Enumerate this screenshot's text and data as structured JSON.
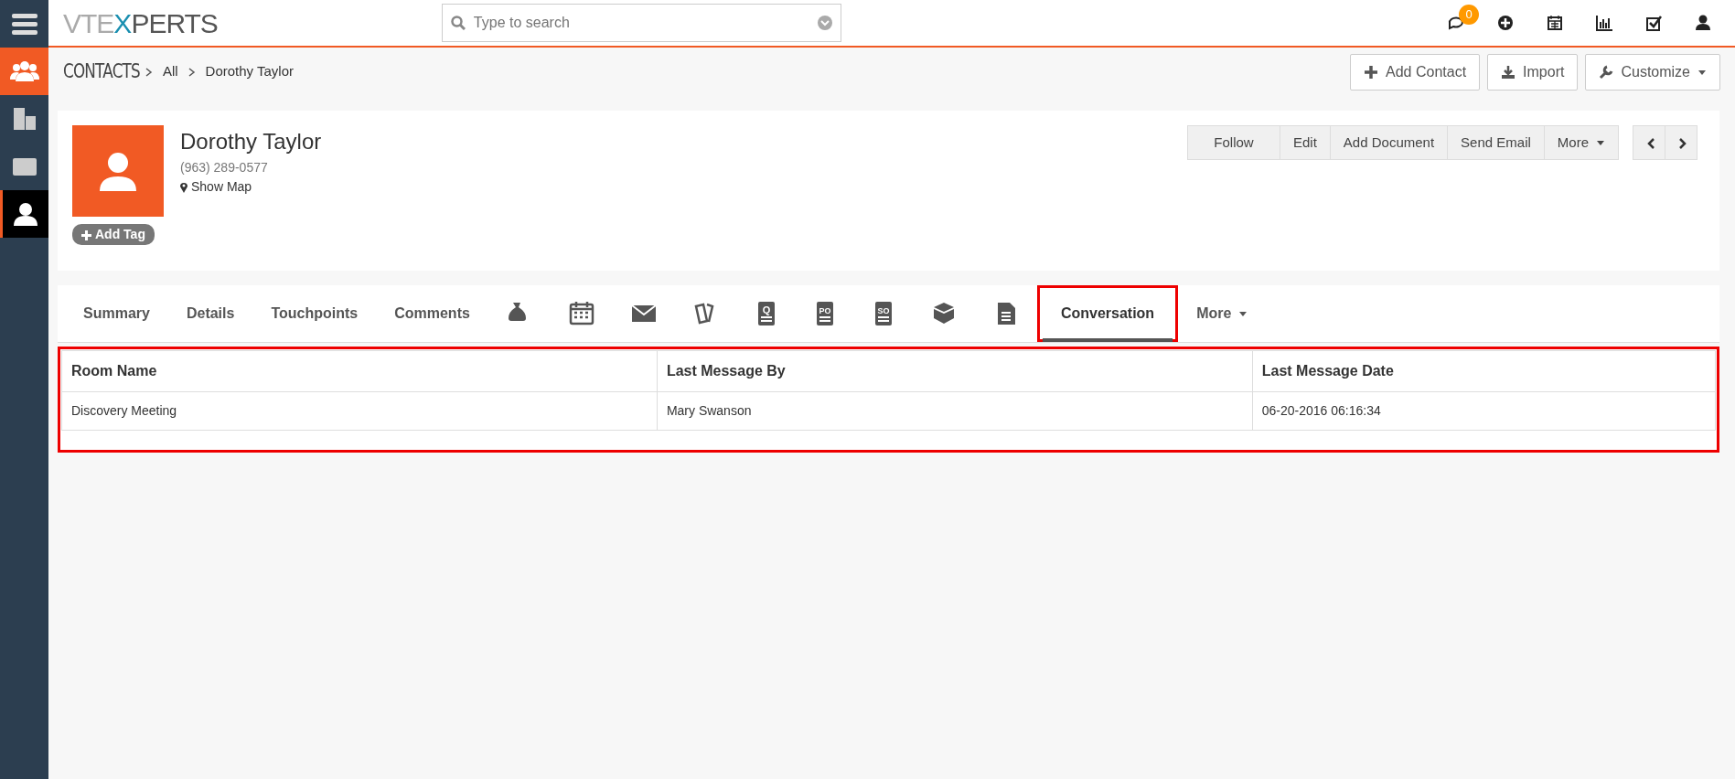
{
  "logo": {
    "part1": "VTE",
    "part2": "X",
    "part3": "PERTS"
  },
  "search": {
    "placeholder": "Type to search"
  },
  "top_icons": [
    {
      "kind": "chat",
      "badge": "0"
    },
    {
      "kind": "plus"
    },
    {
      "kind": "calendar"
    },
    {
      "kind": "chart"
    },
    {
      "kind": "task"
    },
    {
      "kind": "user"
    }
  ],
  "sidebar": {
    "items": [
      {
        "kind": "group",
        "selected": false,
        "color": "#f15a24"
      },
      {
        "kind": "building",
        "selected": false,
        "color": "#2c3e50"
      },
      {
        "kind": "card",
        "selected": false,
        "color": "#2c3e50"
      },
      {
        "kind": "user",
        "selected": true,
        "color": "#000000"
      }
    ]
  },
  "breadcrumb": {
    "module": "CONTACTS",
    "items": [
      "All",
      "Dorothy Taylor"
    ]
  },
  "header_buttons": [
    {
      "kind": "plus",
      "label": "Add Contact"
    },
    {
      "kind": "import",
      "label": "Import"
    },
    {
      "kind": "wrench",
      "label": "Customize",
      "caret": true
    }
  ],
  "record": {
    "name": "Dorothy Taylor",
    "phone": "(963) 289-0577",
    "map": "Show Map",
    "tag_button": "Add Tag"
  },
  "actions": [
    {
      "label": "Follow",
      "caret": false
    },
    {
      "label": "Edit",
      "caret": false
    },
    {
      "label": "Add Document",
      "caret": false
    },
    {
      "label": "Send Email",
      "caret": false
    },
    {
      "label": "More",
      "caret": true
    }
  ],
  "tabs": [
    {
      "kind": "text",
      "label": "Summary",
      "selected": false,
      "highlighted": false
    },
    {
      "kind": "text",
      "label": "Details",
      "selected": false,
      "highlighted": false
    },
    {
      "kind": "text",
      "label": "Touchpoints",
      "selected": false,
      "highlighted": false
    },
    {
      "kind": "text",
      "label": "Comments",
      "selected": false,
      "highlighted": false
    },
    {
      "kind": "money",
      "selected": false,
      "highlighted": false
    },
    {
      "kind": "calendar",
      "selected": false,
      "highlighted": false
    },
    {
      "kind": "mail",
      "selected": false,
      "highlighted": false
    },
    {
      "kind": "tickets",
      "selected": false,
      "highlighted": false
    },
    {
      "kind": "doc",
      "label": "Q",
      "selected": false,
      "highlighted": false
    },
    {
      "kind": "doc",
      "label": "PO",
      "selected": false,
      "highlighted": false
    },
    {
      "kind": "doc",
      "label": "SO",
      "selected": false,
      "highlighted": false
    },
    {
      "kind": "box",
      "selected": false,
      "highlighted": false
    },
    {
      "kind": "file",
      "selected": false,
      "highlighted": false
    },
    {
      "kind": "text",
      "label": "Conversation",
      "selected": true,
      "highlighted": true
    },
    {
      "kind": "text",
      "label": "More",
      "selected": false,
      "highlighted": false,
      "caret": true
    }
  ],
  "table": {
    "highlighted": true,
    "columns": [
      "Room Name",
      "Last Message By",
      "Last Message Date"
    ],
    "rows": [
      [
        "Discovery Meeting",
        "Mary Swanson",
        "06-20-2016 06:16:34"
      ]
    ]
  }
}
